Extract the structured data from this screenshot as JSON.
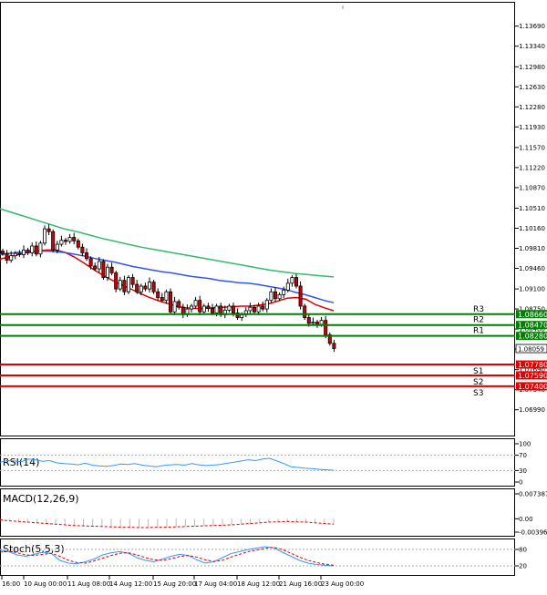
{
  "chart_data": {
    "type": "candlestick",
    "price_axis": {
      "ticks": [
        "1.13690",
        "1.13340",
        "1.12980",
        "1.12630",
        "1.12280",
        "1.11930",
        "1.11570",
        "1.11220",
        "1.10870",
        "1.10510",
        "1.10160",
        "1.09810",
        "1.09460",
        "1.09100",
        "1.08750",
        "1.08400",
        "1.08050",
        "1.07690",
        "1.07340",
        "1.06990"
      ],
      "ylim": [
        1.0681,
        1.1386
      ],
      "current_price": "1.08059"
    },
    "time_axis": {
      "labels": [
        "16:00",
        "10 Aug 00:00",
        "11 Aug 08:00",
        "14 Aug 12:00",
        "15 Aug 20:00",
        "17 Aug 04:00",
        "18 Aug 12:00",
        "21 Aug 16:00",
        "23 Aug 00:00"
      ]
    },
    "levels": [
      {
        "name": "R3",
        "value": 1.0866,
        "tag": "1.08660",
        "color": "#008000"
      },
      {
        "name": "R2",
        "value": 1.0847,
        "tag": "1.08470",
        "color": "#008000"
      },
      {
        "name": "R1",
        "value": 1.0828,
        "tag": "1.08280",
        "color": "#008000"
      },
      {
        "name": "S1",
        "value": 1.0778,
        "tag": "1.07780",
        "color": "#e00000"
      },
      {
        "name": "S2",
        "value": 1.0759,
        "tag": "1.07590",
        "color": "#e00000"
      },
      {
        "name": "S3",
        "value": 1.074,
        "tag": "1.07400",
        "color": "#e00000"
      }
    ],
    "closes": [
      1.0972,
      1.096,
      1.0968,
      1.0972,
      1.097,
      1.0978,
      1.0973,
      1.0985,
      1.0971,
      1.099,
      1.1015,
      1.101,
      1.0978,
      1.0988,
      1.0995,
      1.0993,
      1.1,
      1.0994,
      1.0983,
      1.0973,
      1.0963,
      1.095,
      1.0945,
      1.0958,
      1.093,
      1.0948,
      1.0938,
      1.091,
      1.0925,
      1.0905,
      1.093,
      1.0918,
      1.0905,
      1.0915,
      1.091,
      1.0922,
      1.0905,
      1.0895,
      1.089,
      1.0905,
      1.087,
      1.0888,
      1.0878,
      1.0865,
      1.0875,
      1.088,
      1.089,
      1.087,
      1.088,
      1.0876,
      1.0868,
      1.088,
      1.0865,
      1.0873,
      1.088,
      1.0868,
      1.086,
      1.0865,
      1.0872,
      1.0878,
      1.087,
      1.088,
      1.0875,
      1.089,
      1.0905,
      1.0893,
      1.09,
      1.0908,
      1.092,
      1.093,
      1.0915,
      1.088,
      1.086,
      1.085,
      1.0852,
      1.0848,
      1.0855,
      1.083,
      1.0815,
      1.0806
    ],
    "ma_series": [
      {
        "color": "#e00000",
        "values": [
          1.0962,
          1.0966,
          1.097,
          1.0974,
          1.0976,
          1.0978,
          1.0978,
          1.0974,
          1.0966,
          1.0956,
          1.0945,
          1.0935,
          1.0926,
          1.0918,
          1.0911,
          1.0903,
          1.0896,
          1.089,
          1.0885,
          1.088,
          1.0877,
          1.0876,
          1.0876,
          1.0877,
          1.0878,
          1.0879,
          1.088,
          1.088,
          1.0882,
          1.0884,
          1.0889,
          1.0894,
          1.0895,
          1.0892,
          1.0883,
          1.0877,
          1.0872
        ]
      },
      {
        "color": "#3355ee",
        "values": [
          1.097,
          1.0972,
          1.0974,
          1.0975,
          1.0976,
          1.0976,
          1.0975,
          1.0973,
          1.097,
          1.0967,
          1.0963,
          1.096,
          1.0957,
          1.0953,
          1.0949,
          1.0946,
          1.0943,
          1.094,
          1.0938,
          1.0935,
          1.0932,
          1.093,
          1.0928,
          1.0925,
          1.0923,
          1.0921,
          1.092,
          1.0918,
          1.0915,
          1.0912,
          1.0909,
          1.0904,
          1.09,
          1.0895,
          1.089,
          1.0886
        ]
      },
      {
        "color": "#33bb66",
        "values": [
          1.105,
          1.1043,
          1.1036,
          1.1029,
          1.1022,
          1.1015,
          1.101,
          1.1004,
          1.0998,
          1.0993,
          1.0988,
          1.0983,
          1.0979,
          1.0975,
          1.0971,
          1.0967,
          1.0963,
          1.0959,
          1.0955,
          1.0951,
          1.0947,
          1.0943,
          1.094,
          1.0937,
          1.0935,
          1.0933,
          1.0931
        ]
      }
    ],
    "indicators": [
      {
        "title": "RSI(14)",
        "ticks": [
          "100",
          "70",
          "30",
          "0"
        ],
        "ylim": [
          0,
          100
        ],
        "values": [
          52,
          56,
          55,
          53,
          60,
          58,
          54,
          56,
          50,
          48,
          47,
          45,
          49,
          44,
          42,
          41,
          43,
          47,
          46,
          48,
          44,
          42,
          40,
          43,
          45,
          46,
          44,
          48,
          45,
          43,
          44,
          46,
          49,
          52,
          55,
          58,
          56,
          60,
          62,
          55,
          48,
          40,
          38,
          36,
          35,
          33,
          32,
          31
        ]
      },
      {
        "title": "MACD(12,26,9)",
        "ticks": [
          "0.007387",
          "0.00",
          "-0.003964"
        ],
        "ylim": [
          -0.003964,
          0.007387
        ],
        "values": [
          -0.0003,
          -0.0006,
          -0.0008,
          -0.001,
          -0.0012,
          -0.0014,
          -0.0016,
          -0.0018,
          -0.002,
          -0.0021,
          -0.0022,
          -0.0023,
          -0.0024,
          -0.0025,
          -0.0025,
          -0.0026,
          -0.0026,
          -0.0025,
          -0.0025,
          -0.0024,
          -0.0023,
          -0.0022,
          -0.0021,
          -0.002,
          -0.0019,
          -0.0018,
          -0.0016,
          -0.0014,
          -0.0012,
          -0.001,
          -0.0009,
          -0.0008,
          -0.0009,
          -0.001,
          -0.0012,
          -0.0014,
          -0.0016
        ]
      },
      {
        "title": "Stoch(5,5,3)",
        "ticks": [
          "80",
          "20"
        ],
        "ylim": [
          0,
          100
        ],
        "k": [
          78,
          72,
          60,
          55,
          62,
          70,
          65,
          40,
          30,
          28,
          35,
          45,
          60,
          68,
          72,
          66,
          50,
          40,
          35,
          45,
          55,
          62,
          58,
          42,
          30,
          35,
          50,
          65,
          72,
          80,
          85,
          90,
          86,
          70,
          55,
          40,
          30,
          25,
          22,
          20
        ],
        "d": [
          70,
          74,
          68,
          60,
          58,
          62,
          66,
          55,
          40,
          32,
          30,
          38,
          48,
          58,
          66,
          68,
          60,
          50,
          42,
          40,
          46,
          54,
          58,
          52,
          42,
          36,
          40,
          52,
          62,
          72,
          78,
          84,
          88,
          80,
          66,
          52,
          40,
          32,
          26,
          22
        ]
      }
    ]
  }
}
